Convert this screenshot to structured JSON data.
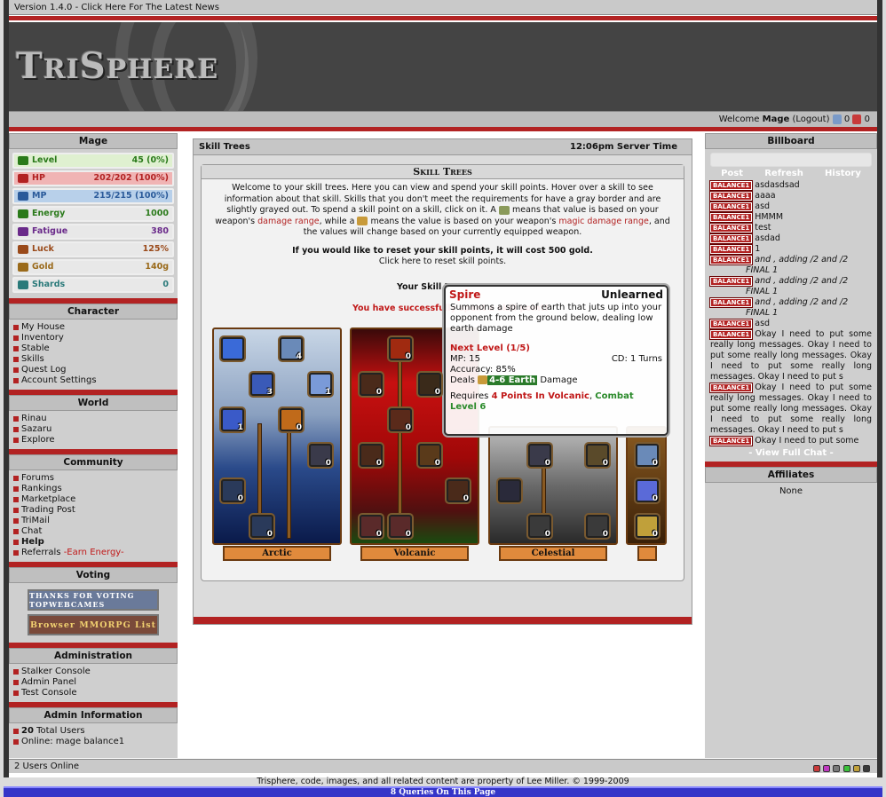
{
  "version_bar": "Version 1.4.0 - Click Here For The Latest News",
  "logo": {
    "big1": "T",
    "small1": "RI",
    "big2": "S",
    "small2": "PHERE"
  },
  "welcome": {
    "prefix": "Welcome",
    "user": "Mage",
    "logout": "(Logout)",
    "gems": "0",
    "potions": "0"
  },
  "left": {
    "mage_header": "Mage",
    "stats": [
      {
        "name": "Level",
        "value": "45 (0%)",
        "bg": "#dff0d0",
        "fg": "#2a7a1a"
      },
      {
        "name": "HP",
        "value": "202/202 (100%)",
        "bg": "#f0b4b4",
        "fg": "#b22222"
      },
      {
        "name": "MP",
        "value": "215/215 (100%)",
        "bg": "#b8d0ea",
        "fg": "#2a5a9a"
      },
      {
        "name": "Energy",
        "value": "1000",
        "bg": "#e8e8e8",
        "fg": "#2a7a1a"
      },
      {
        "name": "Fatigue",
        "value": "380",
        "bg": "#e8e8e8",
        "fg": "#6a2a8a"
      },
      {
        "name": "Luck",
        "value": "125%",
        "bg": "#e8e8e8",
        "fg": "#9a4a1a"
      },
      {
        "name": "Gold",
        "value": "140g",
        "bg": "#e8e8e8",
        "fg": "#9a6a1a"
      },
      {
        "name": "Shards",
        "value": "0",
        "bg": "#e8e8e8",
        "fg": "#2a7a7a"
      }
    ],
    "character_header": "Character",
    "character": [
      "My House",
      "Inventory",
      "Stable",
      "Skills",
      "Quest Log",
      "Account Settings"
    ],
    "world_header": "World",
    "world": [
      "Rinau",
      "Sazaru",
      "Explore"
    ],
    "community_header": "Community",
    "community": [
      "Forums",
      "Rankings",
      "Marketplace",
      "Trading Post",
      "TriMail",
      "Chat",
      "Help"
    ],
    "referrals": "Referrals",
    "earn_energy": "-Earn Energy-",
    "voting_header": "Voting",
    "vote1": "THANKS FOR VOTING TOPWEBCAMES",
    "vote2": "Browser MMORPG List",
    "admin_header": "Administration",
    "admin": [
      "Stalker Console",
      "Admin Panel",
      "Test Console"
    ],
    "admininfo_header": "Admin Information",
    "total_users_num": "20",
    "total_users_label": "Total Users",
    "online": "Online: mage balance1"
  },
  "main": {
    "title": "Skill Trees",
    "server_time": "12:06pm Server Time",
    "panel_title": "Skill Trees",
    "intro1": "Welcome to your skill trees. Here you can view and spend your skill points. Hover over a skill to see information about that skill. Skills that you don't meet the requirements for have a gray border and are slightly grayed out. To spend a skill point on a skill, click on it. A",
    "intro2": "means that value is based on your weapon's",
    "damage_range": "damage range",
    "intro3": ", while a",
    "intro4": "means the value is based on your weapon's",
    "magic_damage_range": "magic damage range",
    "intro5": ", and the values will change based on your currently equipped weapon.",
    "reset_text": "If you would like to reset your skill points, it will cost 500 gold.",
    "reset_link": "Click here to reset skill points.",
    "your_skill": "Your Skill P",
    "success": "You have successfully spent a skill point!",
    "trees": [
      "Arctic",
      "Volcanic",
      "Celestial"
    ]
  },
  "tooltip": {
    "name": "Spire",
    "state": "Unlearned",
    "desc": "Summons a spire of earth that juts up into your opponent from the ground below, dealing low earth damage",
    "next": "Next Level (1/5)",
    "mp": "MP: 15",
    "cd": "CD: 1 Turns",
    "acc": "Accuracy: 85%",
    "deals": "Deals",
    "dmg": "4-6 Earth",
    "damage": "Damage",
    "req": "Requires",
    "req1": "4 Points In Volcanic",
    "req2": "Combat Level 6"
  },
  "right": {
    "billboard_header": "Billboard",
    "post": "Post",
    "refresh": "Refresh",
    "history": "History",
    "tag": "BALANCE1",
    "messages": [
      "asdasdsad",
      "aaaa",
      "asd",
      "HMMM",
      "test",
      "asdad",
      "1"
    ],
    "adding": "and , adding /2 and /2",
    "final": "FINAL 1",
    "asd2": "asd",
    "long": "Okay I need to put some really long messages. Okay I need to put some really long messages. Okay I need to put some really long messages. Okay I need to put s",
    "last": "Okay I need to put some",
    "view_full": "- View Full Chat -",
    "affiliates_header": "Affiliates",
    "affiliates": "None"
  },
  "status": {
    "users_online": "2 Users Online"
  },
  "footer": {
    "copyright": "Trisphere, code, images, and all related content are property of Lee Miller. © 1999-2009",
    "bar": "8 Queries On This Page"
  },
  "colors": {
    "accent": "#b22222",
    "sidebar": "#cfcfcf",
    "header": "#bfbfbf"
  }
}
